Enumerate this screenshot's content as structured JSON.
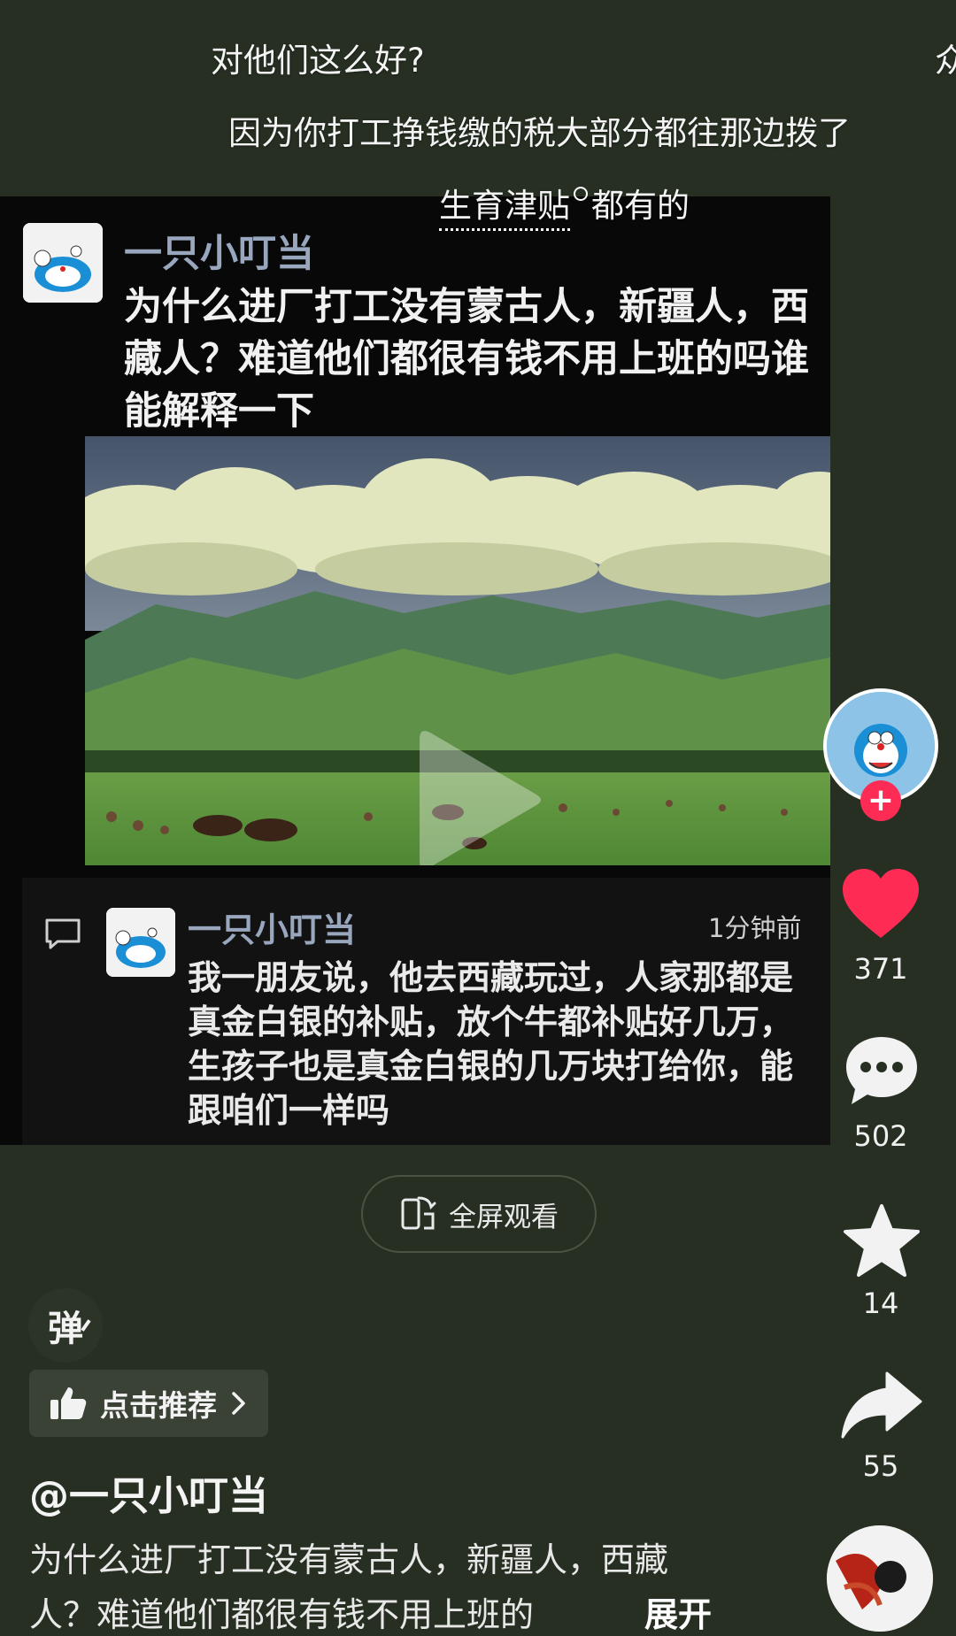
{
  "danmaku": {
    "line1": "对他们这么好?",
    "line1_cut": "众",
    "line2": "因为你打工挣钱缴的税大部分都往那边拨了",
    "line3_link": "生育津贴",
    "line3_rest": "都有的"
  },
  "post": {
    "author": "一只小叮当",
    "text": "为什么进厂打工没有蒙古人，新疆人，西藏人？难道他们都很有钱不用上班的吗谁能解释一下"
  },
  "comment": {
    "author": "一只小叮当",
    "time": "1分钟前",
    "text": "我一朋友说，他去西藏玩过，人家那都是真金白银的补贴，放个牛都补贴好几万，生孩子也是真金白银的几万块打给你，能跟咱们一样吗"
  },
  "rail": {
    "likes": "371",
    "comments": "502",
    "favorites": "14",
    "shares": "55",
    "follow_symbol": "+"
  },
  "fullscreen_label": "全屏观看",
  "danmaku_toggle": "弹",
  "recommend_label": "点击推荐",
  "bottom": {
    "author_handle": "@一只小叮当",
    "desc_line1": "为什么进厂打工没有蒙古人，新疆人，西藏",
    "desc_line2": "人？难道他们都很有钱不用上班的",
    "expand": "展开"
  },
  "colors": {
    "like": "#fe2c55",
    "bg": "#262f22",
    "name": "#98a7be"
  },
  "icons": [
    "play-icon",
    "heart-icon",
    "comment-bubble-icon",
    "star-icon",
    "share-arrow-icon",
    "fullscreen-rotate-icon",
    "thumbs-up-icon",
    "chevron-right-icon",
    "comment-icon"
  ]
}
